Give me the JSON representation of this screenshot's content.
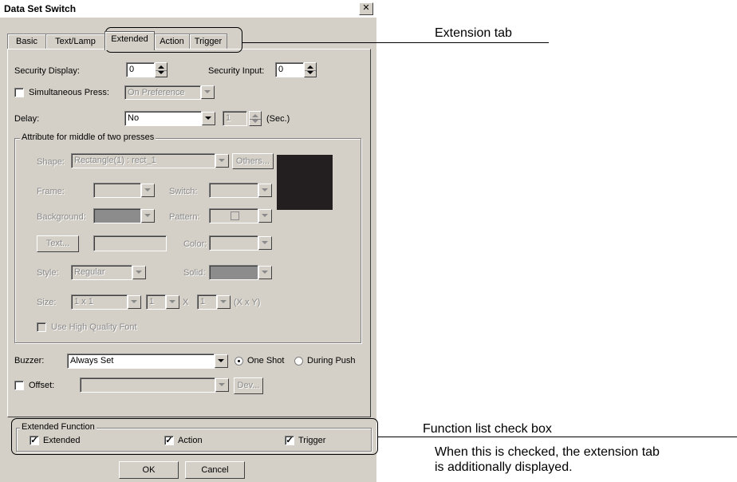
{
  "dialog": {
    "title": "Data Set Switch",
    "close_glyph": "✕",
    "tabs": [
      "Basic",
      "Text/Lamp",
      "Extended",
      "Action",
      "Trigger"
    ],
    "security_display": {
      "label": "Security Display:",
      "value": "0"
    },
    "security_input": {
      "label": "Security Input:",
      "value": "0"
    },
    "simultaneous_press": {
      "label": "Simultaneous Press:",
      "checked": false,
      "value": "On Preference"
    },
    "delay": {
      "label": "Delay:",
      "value": "No",
      "number": "1",
      "unit": "(Sec.)"
    },
    "attr_group": {
      "title": "Attribute for middle of two presses",
      "shape_label": "Shape:",
      "shape_value": "Rectangle(1) : rect_1",
      "others_button": "Others...",
      "frame_label": "Frame:",
      "switch_label": "Switch:",
      "background_label": "Background:",
      "pattern_label": "Pattern:",
      "text_button": "Text...",
      "color_label": "Color:",
      "style_label": "Style:",
      "style_value": "Regular",
      "solid_label": "Solid:",
      "size_label": "Size:",
      "size_value": "1 x 1",
      "size_x": "1",
      "times": "X",
      "size_y": "1",
      "xy_unit": "(X x Y)",
      "hq_font": "Use High Quality Font",
      "preview_color": "#231f20"
    },
    "buzzer": {
      "label": "Buzzer:",
      "value": "Always Set",
      "options": [
        "One Shot",
        "During Push"
      ],
      "selected": "One Shot"
    },
    "offset": {
      "label": "Offset:",
      "checked": false,
      "dev_button": "Dev..."
    },
    "extended_function": {
      "title": "Extended Function",
      "items": [
        {
          "label": "Extended",
          "checked": true
        },
        {
          "label": "Action",
          "checked": true
        },
        {
          "label": "Trigger",
          "checked": true
        }
      ]
    },
    "ok": "OK",
    "cancel": "Cancel"
  },
  "annotations": {
    "extension_tab": "Extension tab",
    "function_list": "Function list check box",
    "function_note_1": "When this is checked, the extension tab",
    "function_note_2": "is additionally displayed."
  }
}
